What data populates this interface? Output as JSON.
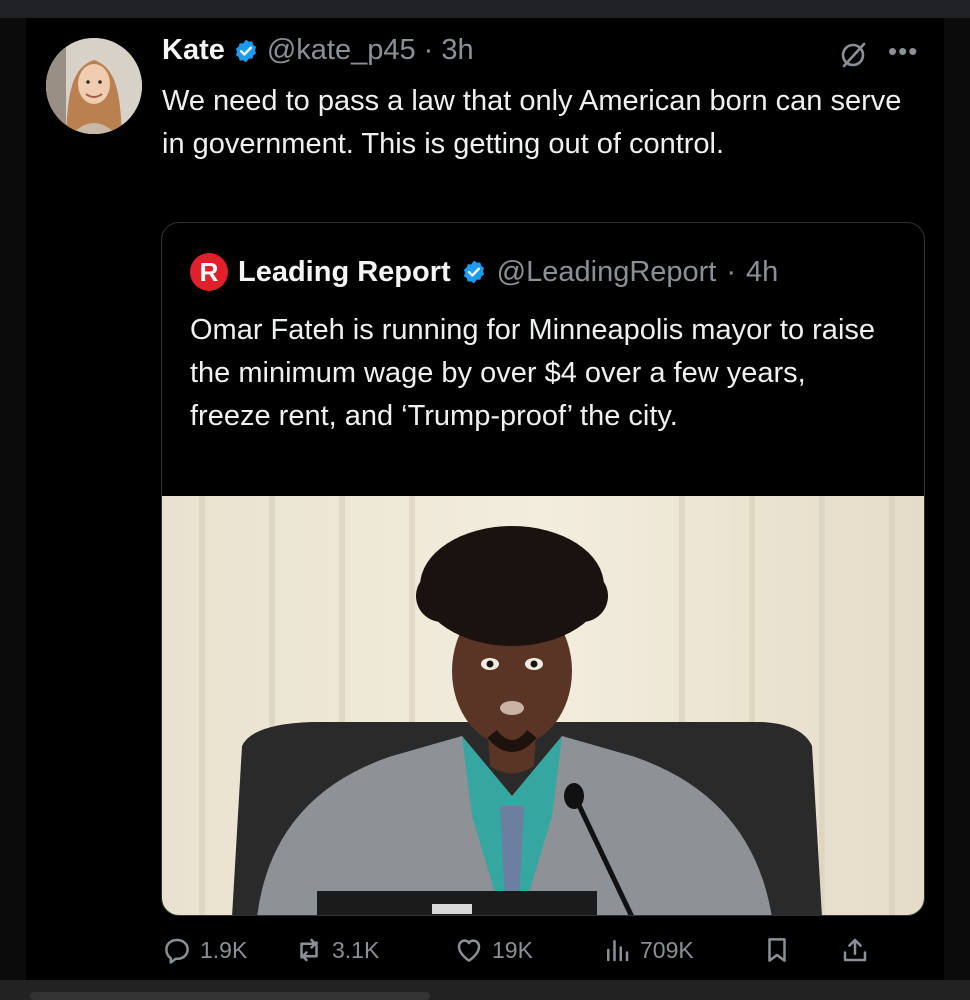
{
  "tweet": {
    "author": {
      "name": "Kate",
      "handle": "@kate_p45",
      "time": "3h"
    },
    "text": "We need to pass a law that only American born can serve in government. This is getting out of control.",
    "quote": {
      "author": {
        "name": "Leading Report",
        "handle": "@LeadingReport",
        "time": "4h",
        "logo_letter": "R"
      },
      "text": "Omar Fateh is running for Minneapolis mayor to raise the minimum wage by over $4 over a few years, freeze rent, and ‘Trump-proof’ the city."
    },
    "actions": {
      "reply_count": "1.9K",
      "repost_count": "3.1K",
      "like_count": "19K",
      "views_count": "709K"
    }
  },
  "colors": {
    "background": "#000000",
    "verified_badge": "#1d9bf0",
    "muted_text": "#8b9097",
    "leading_report_brand": "#e0202a"
  },
  "icons": [
    "verified-badge-icon",
    "grok-icon",
    "more-icon",
    "reply-icon",
    "repost-icon",
    "like-icon",
    "views-icon",
    "bookmark-icon",
    "share-icon"
  ]
}
